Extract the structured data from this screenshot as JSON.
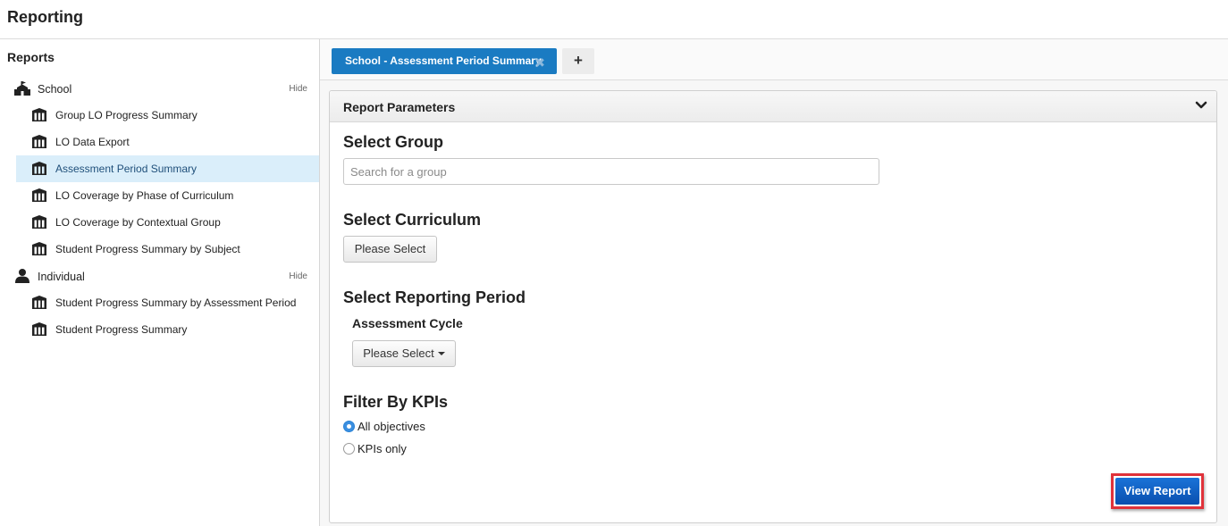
{
  "app": {
    "title": "Reporting"
  },
  "sidebar": {
    "title": "Reports",
    "groups": [
      {
        "label": "School",
        "hide_label": "Hide",
        "icon": "school-icon",
        "items": [
          {
            "label": "Group LO Progress Summary",
            "icon": "report-icon"
          },
          {
            "label": "LO Data Export",
            "icon": "report-icon"
          },
          {
            "label": "Assessment Period Summary",
            "icon": "report-icon",
            "active": true
          },
          {
            "label": "LO Coverage by Phase of Curriculum",
            "icon": "report-icon"
          },
          {
            "label": "LO Coverage by Contextual Group",
            "icon": "report-icon"
          },
          {
            "label": "Student Progress Summary by Subject",
            "icon": "report-icon"
          }
        ]
      },
      {
        "label": "Individual",
        "hide_label": "Hide",
        "icon": "person-icon",
        "items": [
          {
            "label": "Student Progress Summary by Assessment Period",
            "icon": "report-icon"
          },
          {
            "label": "Student Progress Summary",
            "icon": "report-icon"
          }
        ]
      }
    ]
  },
  "tabs": {
    "active_label": "School - Assessment Period Summary",
    "close_glyph": "✖",
    "add_glyph": "+"
  },
  "panel": {
    "title": "Report Parameters",
    "select_group": {
      "title": "Select Group",
      "search_placeholder": "Search for a group"
    },
    "select_curriculum": {
      "title": "Select Curriculum",
      "button_label": "Please Select"
    },
    "select_reporting_period": {
      "title": "Select Reporting Period",
      "subtitle": "Assessment Cycle",
      "dropdown_label": "Please Select"
    },
    "filter_kpis": {
      "title": "Filter By KPIs",
      "options": [
        {
          "label": "All objectives",
          "checked": true
        },
        {
          "label": "KPIs only",
          "checked": false
        }
      ]
    },
    "view_report_label": "View Report"
  },
  "colors": {
    "tab_active": "#1a7bc2",
    "selected_row": "#daeefa",
    "primary_button": "#0a5fc4",
    "highlight_border": "#e0323a"
  }
}
